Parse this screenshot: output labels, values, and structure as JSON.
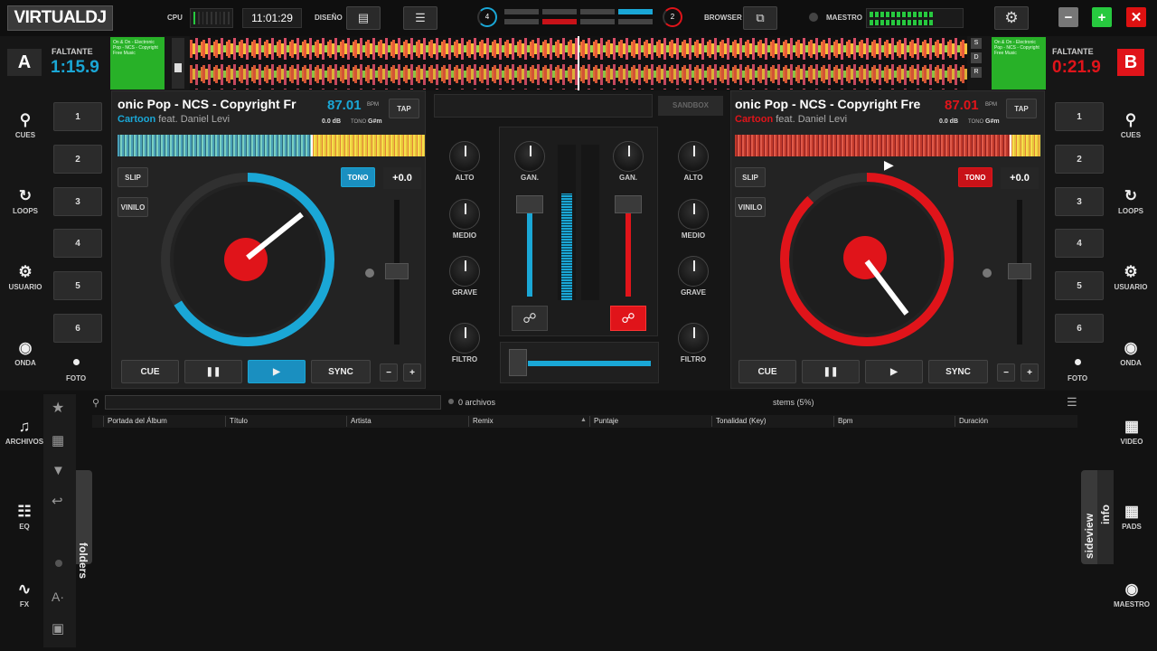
{
  "topbar": {
    "logo": "VIRTUALDJ",
    "cpu_label": "CPU",
    "clock": "11:01:29",
    "design_label": "DISEÑO",
    "browser_label": "BROWSER",
    "master_label": "MAESTRO",
    "deck_left_num": "4",
    "deck_right_num": "2"
  },
  "deck_a": {
    "letter": "A",
    "remaining_label": "FALTANTE",
    "remaining": "1:15.9",
    "title": "onic Pop - NCS - Copyright Fr",
    "artist_main": "Cartoon",
    "artist_rest": " feat. Daniel Levi",
    "bpm": "87.01",
    "bpm_label": "BPM",
    "gain_db": "0.0 dB",
    "key_label": "TONO",
    "key": "G#m",
    "tap": "TAP",
    "slip": "SLIP",
    "vinyl": "VINILO",
    "tono": "TONO",
    "pitch": "+0.0",
    "cue": "CUE",
    "sync": "SYNC",
    "thumb_text": "On & On - Electronic Pop - NCS - Copyright Free Music",
    "accent": "#1aa7d6",
    "progress": 0.55
  },
  "deck_b": {
    "letter": "B",
    "remaining_label": "FALTANTE",
    "remaining": "0:21.9",
    "title": "onic Pop - NCS - Copyright Fre",
    "artist_main": "Cartoon",
    "artist_rest": " feat. Daniel Levi",
    "bpm": "87.01",
    "bpm_label": "BPM",
    "gain_db": "0.0 dB",
    "key_label": "TONO",
    "key": "G#m",
    "tap": "TAP",
    "slip": "SLIP",
    "vinyl": "VINILO",
    "tono": "TONO",
    "pitch": "+0.0",
    "cue": "CUE",
    "sync": "SYNC",
    "thumb_text": "On & On - Electronic Pop - NCS - Copyright Free Music",
    "accent": "#e0141a",
    "progress": 0.88
  },
  "pads": [
    "1",
    "2",
    "3",
    "4",
    "5",
    "6"
  ],
  "left_sidebar": [
    "CUES",
    "LOOPS",
    "USUARIO",
    "ONDA",
    "FOTO"
  ],
  "right_sidebar": [
    "CUES",
    "LOOPS",
    "USUARIO",
    "ONDA",
    "FOTO"
  ],
  "mixer": {
    "sandbox": "SANDBOX",
    "alto": "ALTO",
    "medio": "MEDIO",
    "grave": "GRAVE",
    "filtro": "FILTRO",
    "gan": "GAN.",
    "strip_letters": [
      "S",
      "D",
      "R"
    ]
  },
  "browser": {
    "files_count": "0 archivos",
    "stems": "stems (5%)",
    "columns": [
      "Portada del Álbum",
      "Título",
      "Artista",
      "Remix",
      "Puntaje",
      "Tonalidad (Key)",
      "Bpm",
      "Duración"
    ],
    "folders_tab": "folders",
    "sideview_tab": "sideview",
    "info_tab": "info",
    "left_tools": [
      "ARCHIVOS",
      "EQ",
      "FX"
    ],
    "right_tools": [
      "VIDEO",
      "PADS",
      "MAESTRO"
    ]
  },
  "colors": {
    "deck_a": "#1aa7d6",
    "deck_b": "#e0141a",
    "green": "#27c93f"
  }
}
